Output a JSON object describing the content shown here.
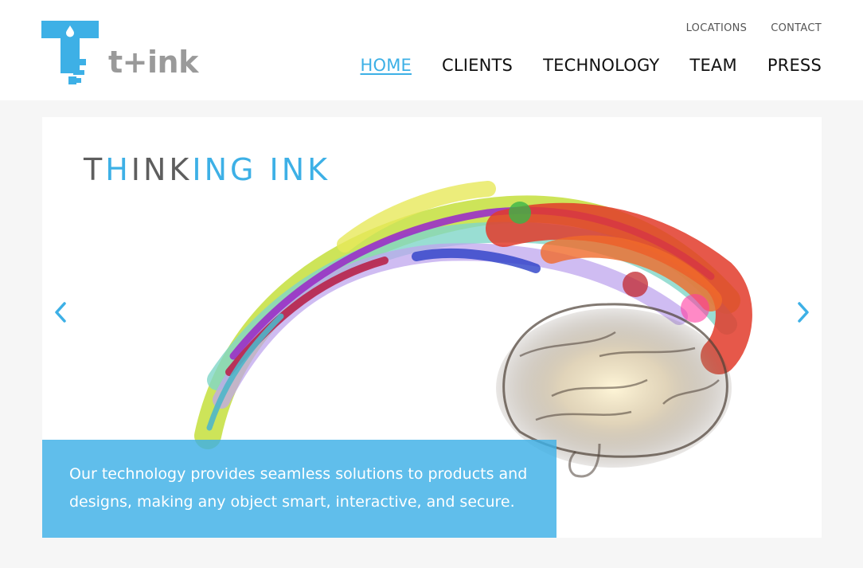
{
  "brand": {
    "name": "t+ink",
    "accent": "#3db0e6"
  },
  "util_nav": [
    {
      "label": "LOCATIONS"
    },
    {
      "label": "CONTACT"
    }
  ],
  "main_nav": [
    {
      "label": "HOME",
      "active": true
    },
    {
      "label": "CLIENTS",
      "active": false
    },
    {
      "label": "TECHNOLOGY",
      "active": false
    },
    {
      "label": "TEAM",
      "active": false
    },
    {
      "label": "PRESS",
      "active": false
    }
  ],
  "hero": {
    "headline_parts": [
      "T",
      "H",
      "INK",
      "ING INK"
    ],
    "caption": "Our technology provides seamless solutions to products and designs, making any object smart, interactive, and secure.",
    "prev_icon": "chevron-left-icon",
    "next_icon": "chevron-right-icon"
  }
}
